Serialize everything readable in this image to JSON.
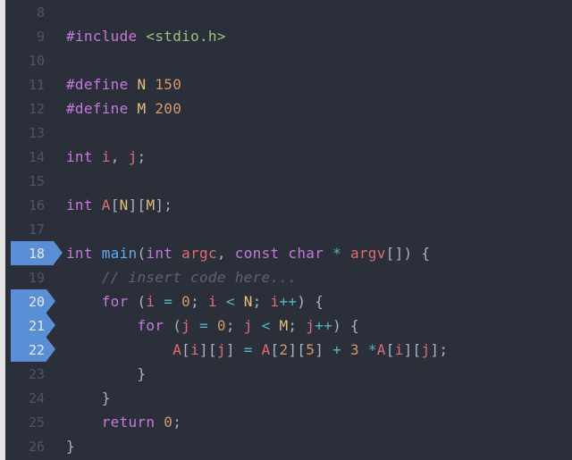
{
  "lines": [
    {
      "num": "8",
      "marker": null,
      "tokens": []
    },
    {
      "num": "9",
      "marker": null,
      "tokens": [
        {
          "c": "tok-pre",
          "t": "#include "
        },
        {
          "c": "tok-inc",
          "t": "<stdio.h>"
        }
      ]
    },
    {
      "num": "10",
      "marker": null,
      "tokens": []
    },
    {
      "num": "11",
      "marker": null,
      "tokens": [
        {
          "c": "tok-pre",
          "t": "#define "
        },
        {
          "c": "tok-macro",
          "t": "N"
        },
        {
          "c": "",
          "t": " "
        },
        {
          "c": "tok-num",
          "t": "150"
        }
      ]
    },
    {
      "num": "12",
      "marker": null,
      "tokens": [
        {
          "c": "tok-pre",
          "t": "#define "
        },
        {
          "c": "tok-macro",
          "t": "M"
        },
        {
          "c": "",
          "t": " "
        },
        {
          "c": "tok-num",
          "t": "200"
        }
      ]
    },
    {
      "num": "13",
      "marker": null,
      "tokens": []
    },
    {
      "num": "14",
      "marker": null,
      "tokens": [
        {
          "c": "tok-type",
          "t": "int"
        },
        {
          "c": "",
          "t": " "
        },
        {
          "c": "tok-ident",
          "t": "i"
        },
        {
          "c": "tok-punc",
          "t": ", "
        },
        {
          "c": "tok-ident",
          "t": "j"
        },
        {
          "c": "tok-punc",
          "t": ";"
        }
      ]
    },
    {
      "num": "15",
      "marker": null,
      "tokens": []
    },
    {
      "num": "16",
      "marker": null,
      "tokens": [
        {
          "c": "tok-type",
          "t": "int"
        },
        {
          "c": "",
          "t": " "
        },
        {
          "c": "tok-ident",
          "t": "A"
        },
        {
          "c": "tok-punc",
          "t": "["
        },
        {
          "c": "tok-macro",
          "t": "N"
        },
        {
          "c": "tok-punc",
          "t": "]["
        },
        {
          "c": "tok-macro",
          "t": "M"
        },
        {
          "c": "tok-punc",
          "t": "];"
        }
      ]
    },
    {
      "num": "17",
      "marker": null,
      "tokens": []
    },
    {
      "num": "18",
      "marker": "main",
      "tokens": [
        {
          "c": "tok-type",
          "t": "int"
        },
        {
          "c": "",
          "t": " "
        },
        {
          "c": "tok-func",
          "t": "main"
        },
        {
          "c": "tok-punc",
          "t": "("
        },
        {
          "c": "tok-type",
          "t": "int"
        },
        {
          "c": "",
          "t": " "
        },
        {
          "c": "tok-ident",
          "t": "argc"
        },
        {
          "c": "tok-punc",
          "t": ", "
        },
        {
          "c": "tok-type",
          "t": "const"
        },
        {
          "c": "",
          "t": " "
        },
        {
          "c": "tok-type",
          "t": "char"
        },
        {
          "c": "",
          "t": " "
        },
        {
          "c": "tok-op",
          "t": "*"
        },
        {
          "c": "",
          "t": " "
        },
        {
          "c": "tok-ident",
          "t": "argv"
        },
        {
          "c": "tok-punc",
          "t": "[]) {"
        }
      ]
    },
    {
      "num": "19",
      "marker": null,
      "tokens": [
        {
          "c": "",
          "t": "    "
        },
        {
          "c": "tok-cmt",
          "t": "// insert code here..."
        }
      ]
    },
    {
      "num": "20",
      "marker": "sub",
      "tokens": [
        {
          "c": "",
          "t": "    "
        },
        {
          "c": "tok-kw",
          "t": "for"
        },
        {
          "c": "",
          "t": " "
        },
        {
          "c": "tok-punc",
          "t": "("
        },
        {
          "c": "tok-ident",
          "t": "i"
        },
        {
          "c": "",
          "t": " "
        },
        {
          "c": "tok-op",
          "t": "="
        },
        {
          "c": "",
          "t": " "
        },
        {
          "c": "tok-num",
          "t": "0"
        },
        {
          "c": "tok-punc",
          "t": "; "
        },
        {
          "c": "tok-ident",
          "t": "i"
        },
        {
          "c": "",
          "t": " "
        },
        {
          "c": "tok-op",
          "t": "<"
        },
        {
          "c": "",
          "t": " "
        },
        {
          "c": "tok-macro",
          "t": "N"
        },
        {
          "c": "tok-punc",
          "t": "; "
        },
        {
          "c": "tok-ident",
          "t": "i"
        },
        {
          "c": "tok-op",
          "t": "++"
        },
        {
          "c": "tok-punc",
          "t": ") {"
        }
      ]
    },
    {
      "num": "21",
      "marker": "sub",
      "tokens": [
        {
          "c": "",
          "t": "        "
        },
        {
          "c": "tok-kw",
          "t": "for"
        },
        {
          "c": "",
          "t": " "
        },
        {
          "c": "tok-punc",
          "t": "("
        },
        {
          "c": "tok-ident",
          "t": "j"
        },
        {
          "c": "",
          "t": " "
        },
        {
          "c": "tok-op",
          "t": "="
        },
        {
          "c": "",
          "t": " "
        },
        {
          "c": "tok-num",
          "t": "0"
        },
        {
          "c": "tok-punc",
          "t": "; "
        },
        {
          "c": "tok-ident",
          "t": "j"
        },
        {
          "c": "",
          "t": " "
        },
        {
          "c": "tok-op",
          "t": "<"
        },
        {
          "c": "",
          "t": " "
        },
        {
          "c": "tok-macro",
          "t": "M"
        },
        {
          "c": "tok-punc",
          "t": "; "
        },
        {
          "c": "tok-ident",
          "t": "j"
        },
        {
          "c": "tok-op",
          "t": "++"
        },
        {
          "c": "tok-punc",
          "t": ") {"
        }
      ]
    },
    {
      "num": "22",
      "marker": "sub",
      "tokens": [
        {
          "c": "",
          "t": "            "
        },
        {
          "c": "tok-ident",
          "t": "A"
        },
        {
          "c": "tok-punc",
          "t": "["
        },
        {
          "c": "tok-ident",
          "t": "i"
        },
        {
          "c": "tok-punc",
          "t": "]["
        },
        {
          "c": "tok-ident",
          "t": "j"
        },
        {
          "c": "tok-punc",
          "t": "] "
        },
        {
          "c": "tok-op",
          "t": "="
        },
        {
          "c": "",
          "t": " "
        },
        {
          "c": "tok-ident",
          "t": "A"
        },
        {
          "c": "tok-punc",
          "t": "["
        },
        {
          "c": "tok-num",
          "t": "2"
        },
        {
          "c": "tok-punc",
          "t": "]["
        },
        {
          "c": "tok-num",
          "t": "5"
        },
        {
          "c": "tok-punc",
          "t": "] "
        },
        {
          "c": "tok-op",
          "t": "+"
        },
        {
          "c": "",
          "t": " "
        },
        {
          "c": "tok-num",
          "t": "3"
        },
        {
          "c": "",
          "t": " "
        },
        {
          "c": "tok-op",
          "t": "*"
        },
        {
          "c": "tok-ident",
          "t": "A"
        },
        {
          "c": "tok-punc",
          "t": "["
        },
        {
          "c": "tok-ident",
          "t": "i"
        },
        {
          "c": "tok-punc",
          "t": "]["
        },
        {
          "c": "tok-ident",
          "t": "j"
        },
        {
          "c": "tok-punc",
          "t": "];"
        }
      ]
    },
    {
      "num": "23",
      "marker": null,
      "tokens": [
        {
          "c": "",
          "t": "        "
        },
        {
          "c": "tok-punc",
          "t": "}"
        }
      ]
    },
    {
      "num": "24",
      "marker": null,
      "tokens": [
        {
          "c": "",
          "t": "    "
        },
        {
          "c": "tok-punc",
          "t": "}"
        }
      ]
    },
    {
      "num": "25",
      "marker": null,
      "tokens": [
        {
          "c": "",
          "t": "    "
        },
        {
          "c": "tok-kw",
          "t": "return"
        },
        {
          "c": "",
          "t": " "
        },
        {
          "c": "tok-num",
          "t": "0"
        },
        {
          "c": "tok-punc",
          "t": ";"
        }
      ]
    },
    {
      "num": "26",
      "marker": null,
      "tokens": [
        {
          "c": "tok-punc",
          "t": "}"
        }
      ]
    }
  ]
}
